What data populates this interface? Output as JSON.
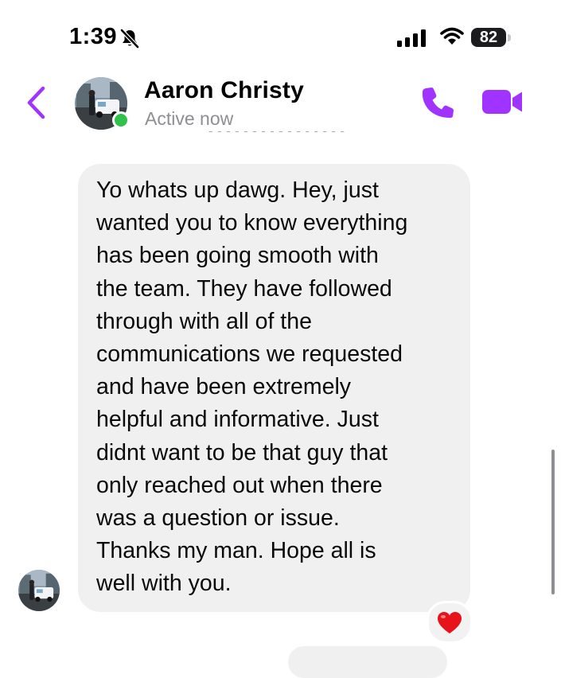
{
  "status_bar": {
    "time": "1:39",
    "battery_level": "82"
  },
  "header": {
    "contact_name": "Aaron Christy",
    "presence": "Active now",
    "accent_color": "#a033ff",
    "online_color": "#31c24d",
    "icons": [
      "back-chevron-icon",
      "phone-icon",
      "video-camera-icon"
    ]
  },
  "message": {
    "text": "Yo whats up dawg. Hey, just\nwanted you to know everything\nhas been going smooth with\nthe team. They have followed\nthrough with all of the\ncommunications we requested\nand have been extremely\nhelpful and informative. Just\ndidnt want to be that guy that\nonly reached out when there\nwas a question or issue.\nThanks my man. Hope all is\nwell with you.",
    "reaction": "❤️"
  }
}
